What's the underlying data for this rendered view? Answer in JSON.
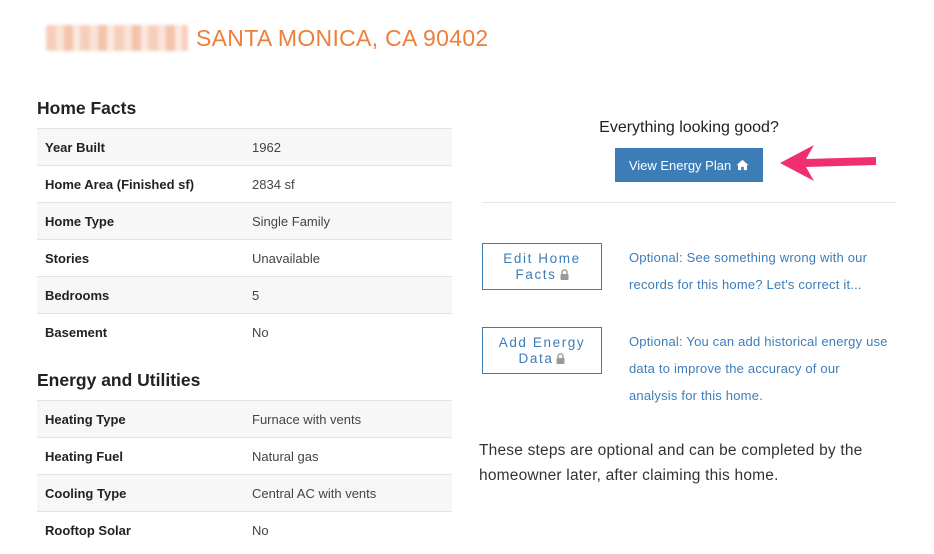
{
  "header": {
    "address": "SANTA MONICA, CA 90402"
  },
  "home_facts": {
    "title": "Home Facts",
    "rows": [
      {
        "label": "Year Built",
        "value": "1962"
      },
      {
        "label": "Home Area (Finished sf)",
        "value": "2834 sf"
      },
      {
        "label": "Home Type",
        "value": "Single Family"
      },
      {
        "label": "Stories",
        "value": "Unavailable"
      },
      {
        "label": "Bedrooms",
        "value": "5"
      },
      {
        "label": "Basement",
        "value": "No"
      }
    ]
  },
  "energy_utilities": {
    "title": "Energy and Utilities",
    "rows": [
      {
        "label": "Heating Type",
        "value": "Furnace with vents"
      },
      {
        "label": "Heating Fuel",
        "value": "Natural gas"
      },
      {
        "label": "Cooling Type",
        "value": "Central AC with vents"
      },
      {
        "label": "Rooftop Solar",
        "value": "No"
      }
    ]
  },
  "plan": {
    "prompt": "Everything looking good?",
    "button_label": "View Energy Plan",
    "button_icon": "home-icon",
    "accent_color": "#3c7db8",
    "arrow_color": "#f0306e"
  },
  "edit_home": {
    "button_line1": "Edit Home",
    "button_line2": "Facts",
    "icon": "lock-icon",
    "description": "Optional: See something wrong with our records for this home? Let's correct it..."
  },
  "add_energy": {
    "button_line1": "Add Energy",
    "button_line2": "Data",
    "icon": "lock-icon",
    "description": "Optional: You can add historical energy use data to improve the accuracy of our analysis for this home."
  },
  "steps_note": "These steps are optional and can be completed by the homeowner later, after claiming this home."
}
